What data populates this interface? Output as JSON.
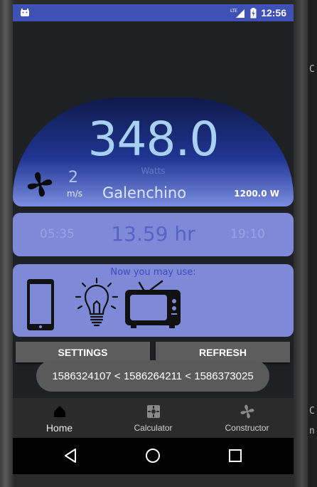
{
  "status_bar": {
    "time": "12:56",
    "network": "LTE",
    "color": "#3f51b5"
  },
  "gauge": {
    "power_value": "348.0",
    "power_unit": "Watts",
    "wind_speed": "2",
    "wind_unit": "m/s",
    "location": "Galenchino",
    "capacity": "1200.0 W"
  },
  "time_panel": {
    "start": "05:35",
    "duration": "13.59 hr",
    "end": "19:10"
  },
  "usage": {
    "title": "Now you may use:",
    "devices": [
      "phone-icon",
      "bulb-icon",
      "tv-icon"
    ]
  },
  "buttons": {
    "settings": "SETTINGS",
    "refresh": "REFRESH"
  },
  "toast": {
    "text": "1586324107 < 1586264211 < 1586373025"
  },
  "bottom_nav": {
    "items": [
      {
        "label": "Home",
        "icon": "home-icon",
        "active": true
      },
      {
        "label": "Calculator",
        "icon": "calculator-icon",
        "active": false
      },
      {
        "label": "Constructor",
        "icon": "fan-icon",
        "active": false
      }
    ]
  },
  "colors": {
    "panel": "#7e8ad8",
    "accent": "#3f51b5",
    "power_text": "#a8d0f0"
  }
}
